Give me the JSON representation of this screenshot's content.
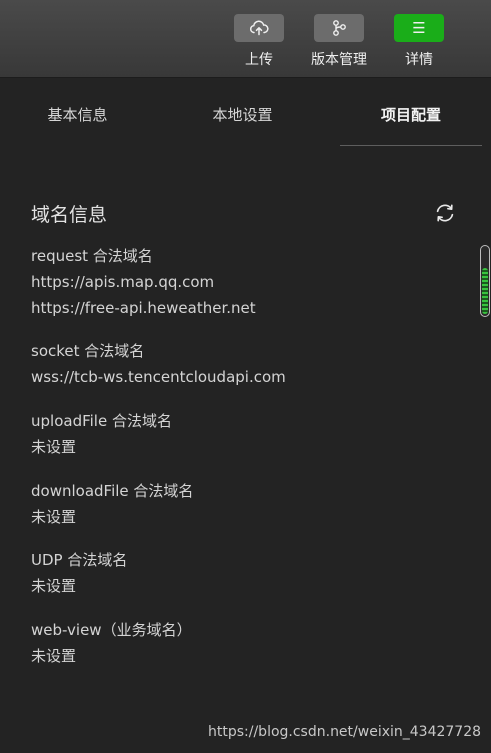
{
  "toolbar": {
    "upload_label": "上传",
    "version_label": "版本管理",
    "details_label": "详情",
    "details_icon": "☰",
    "active_color": "#1aad19"
  },
  "tabs": [
    {
      "label": "基本信息",
      "active": false
    },
    {
      "label": "本地设置",
      "active": false
    },
    {
      "label": "项目配置",
      "active": true
    }
  ],
  "domain_info": {
    "title": "域名信息",
    "groups": [
      {
        "label": "request 合法域名",
        "values": [
          "https://apis.map.qq.com",
          "https://free-api.heweather.net"
        ]
      },
      {
        "label": "socket 合法域名",
        "values": [
          "wss://tcb-ws.tencentcloudapi.com"
        ]
      },
      {
        "label": "uploadFile 合法域名",
        "values": [
          "未设置"
        ]
      },
      {
        "label": "downloadFile 合法域名",
        "values": [
          "未设置"
        ]
      },
      {
        "label": "UDP 合法域名",
        "values": [
          "未设置"
        ]
      },
      {
        "label": "web-view（业务域名）",
        "values": [
          "未设置"
        ]
      }
    ]
  },
  "watermark": "https://blog.csdn.net/weixin_43427728"
}
